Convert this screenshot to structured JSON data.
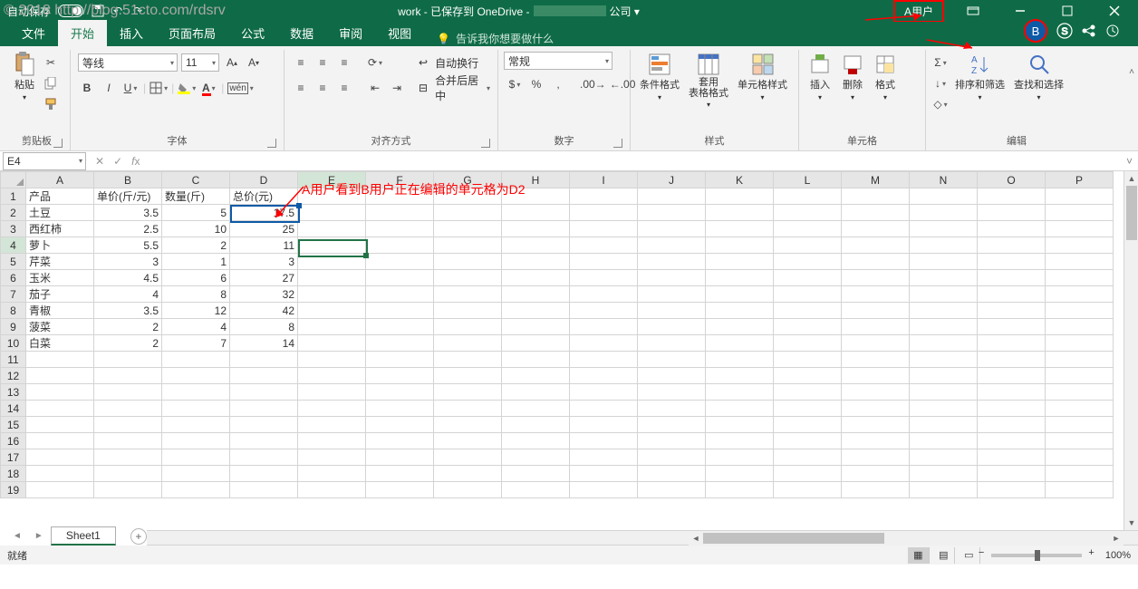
{
  "watermark": "© 2018 http://blog.51cto.com/rdsrv",
  "annotation": "A用户看到B用户正在编辑的单元格为D2",
  "titlebar": {
    "autosave": "自动保存",
    "autosave_state": "开",
    "doc_title": "work  -  已保存到 OneDrive -",
    "company_suffix": "公司 ▾",
    "user_a": "A用户"
  },
  "tabs": {
    "file": "文件",
    "home": "开始",
    "insert": "插入",
    "layout": "页面布局",
    "formulas": "公式",
    "data": "数据",
    "review": "审阅",
    "view": "视图",
    "tellme": "告诉我你想要做什么"
  },
  "collab_avatar": "B",
  "ribbon": {
    "clipboard": {
      "paste": "粘贴",
      "label": "剪贴板"
    },
    "font": {
      "name": "等线",
      "size": "11",
      "label": "字体"
    },
    "align": {
      "wrap": "自动换行",
      "merge": "合并后居中",
      "label": "对齐方式"
    },
    "number": {
      "format": "常规",
      "label": "数字"
    },
    "styles": {
      "cond": "条件格式",
      "table": "套用\n表格格式",
      "cell": "单元格样式",
      "label": "样式"
    },
    "cells": {
      "insert": "插入",
      "delete": "删除",
      "format": "格式",
      "label": "单元格"
    },
    "editing": {
      "sort": "排序和筛选",
      "find": "查找和选择",
      "label": "编辑"
    }
  },
  "namebox": "E4",
  "columns": [
    "A",
    "B",
    "C",
    "D",
    "E",
    "F",
    "G",
    "H",
    "I",
    "J",
    "K",
    "L",
    "M",
    "N",
    "O",
    "P"
  ],
  "headers": {
    "a": "产品",
    "b": "单价(斤/元)",
    "c": "数量(斤)",
    "d": "总价(元)"
  },
  "rows": [
    {
      "a": "土豆",
      "b": "3.5",
      "c": "5",
      "d": "17.5"
    },
    {
      "a": "西红柿",
      "b": "2.5",
      "c": "10",
      "d": "25"
    },
    {
      "a": "萝卜",
      "b": "5.5",
      "c": "2",
      "d": "11"
    },
    {
      "a": "芹菜",
      "b": "3",
      "c": "1",
      "d": "3"
    },
    {
      "a": "玉米",
      "b": "4.5",
      "c": "6",
      "d": "27"
    },
    {
      "a": "茄子",
      "b": "4",
      "c": "8",
      "d": "32"
    },
    {
      "a": "青椒",
      "b": "3.5",
      "c": "12",
      "d": "42"
    },
    {
      "a": "菠菜",
      "b": "2",
      "c": "4",
      "d": "8"
    },
    {
      "a": "白菜",
      "b": "2",
      "c": "7",
      "d": "14"
    }
  ],
  "sheet_tab": "Sheet1",
  "status": {
    "ready": "就绪",
    "zoom": "100%"
  }
}
